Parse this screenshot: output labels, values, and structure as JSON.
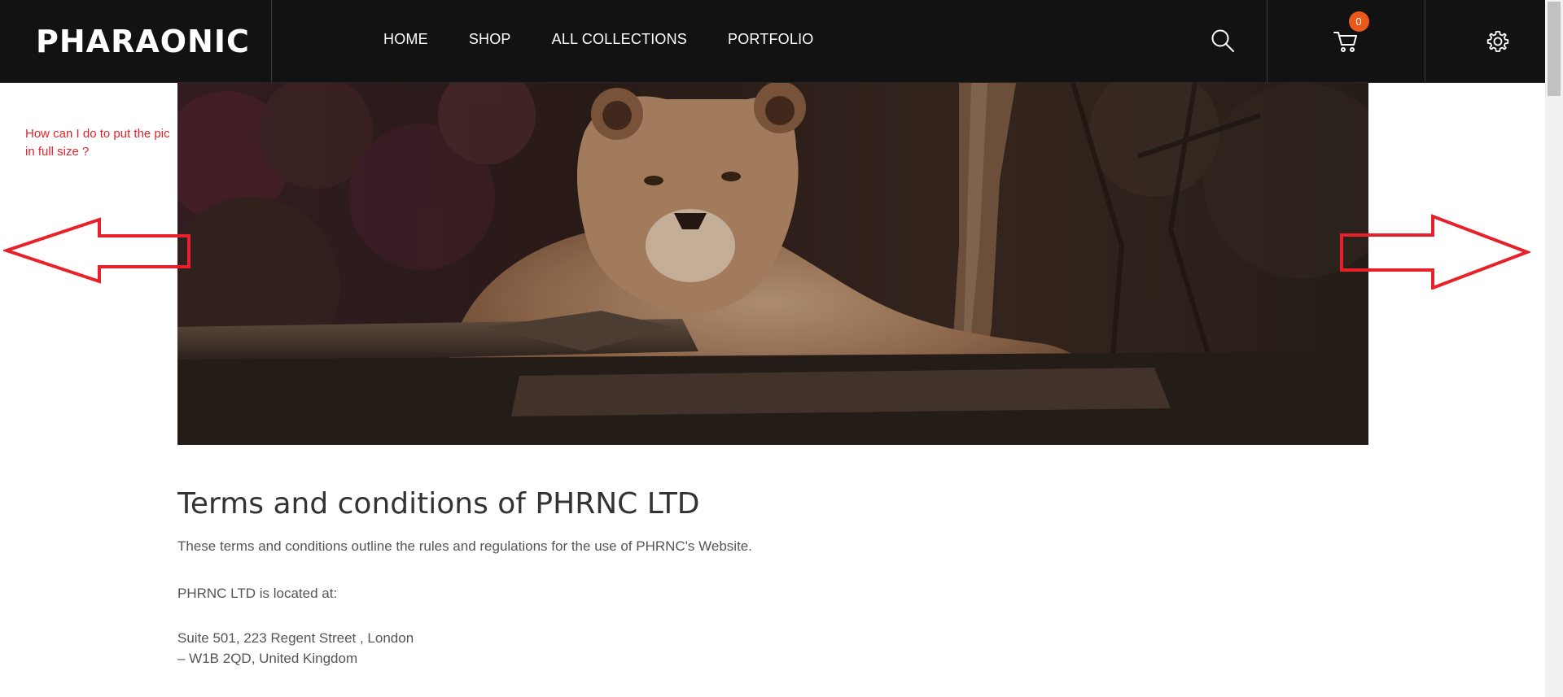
{
  "header": {
    "logo": "PHARAONIC",
    "nav": [
      "HOME",
      "SHOP",
      "ALL COLLECTIONS",
      "PORTFOLIO"
    ],
    "cart_count": "0",
    "icons": [
      "search-icon",
      "cart-icon",
      "gear-icon"
    ]
  },
  "annotation": {
    "text": "How can I do to put the pic in full size ?",
    "color": "#e8202a"
  },
  "content": {
    "title": "Terms and conditions of PHRNC LTD",
    "intro": "These terms and conditions outline the rules and regulations for the use of PHRNC's Website.",
    "located_label": "PHRNC LTD is located at:",
    "address_line1": "Suite 501, 223 Regent Street , London",
    "address_line2": "– W1B 2QD, United Kingdom"
  },
  "colors": {
    "header_bg": "#121212",
    "badge": "#e8591a",
    "annotation": "#e8202a"
  }
}
